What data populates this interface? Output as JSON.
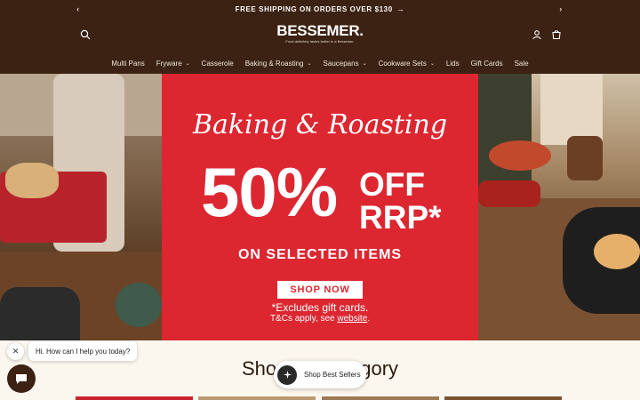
{
  "announcement": {
    "text": "FREE SHIPPING ON ORDERS OVER $130"
  },
  "header": {
    "logo": {
      "brand": "BESSEMER.",
      "tagline": "Food definitely tastes better in a Bessemer."
    }
  },
  "nav": {
    "items": [
      {
        "label": "Multi Pans",
        "dropdown": false
      },
      {
        "label": "Fryware",
        "dropdown": true
      },
      {
        "label": "Casserole",
        "dropdown": false
      },
      {
        "label": "Baking & Roasting",
        "dropdown": true
      },
      {
        "label": "Saucepans",
        "dropdown": true
      },
      {
        "label": "Cookware Sets",
        "dropdown": true
      },
      {
        "label": "Lids",
        "dropdown": false
      },
      {
        "label": "Gift Cards",
        "dropdown": false
      },
      {
        "label": "Sale",
        "dropdown": false
      }
    ]
  },
  "hero": {
    "script_title": "Baking & Roasting",
    "percent": "50%",
    "off_line1": "OFF",
    "off_line2": "RRP*",
    "subtitle": "ON SELECTED ITEMS",
    "button": "SHOP NOW",
    "excludes": "*Excludes gift cards.",
    "tcs_prefix": "T&Cs apply, see ",
    "tcs_link": "website",
    "tcs_suffix": ".",
    "red": "#dc2731"
  },
  "category": {
    "title": "Shop by Category"
  },
  "chat": {
    "greeting": "Hi. How can I help you today?"
  },
  "best_sellers": {
    "label": "Shop Best Sellers"
  },
  "colors": {
    "brand_brown": "#3b2212",
    "cream": "#fbf6ee"
  }
}
